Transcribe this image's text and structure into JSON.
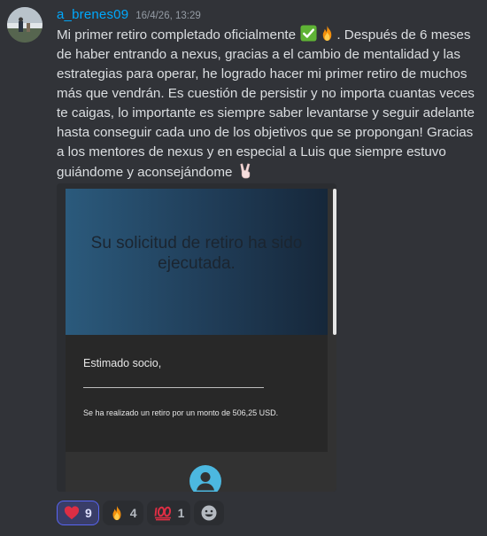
{
  "message": {
    "username": "a_brenes09",
    "timestamp": "16/4/26, 13:29",
    "text_part1": "Mi primer retiro completado oficialmente ",
    "text_part2": ". Después de 6 meses de haber entrando a nexus, gracias a el cambio de mentalidad y las estrategias para operar, he logrado hacer mi primer retiro de muchos más que vendrán. Es cuestión de persistir y no importa cuantas veces te caigas, lo importante es siempre saber levantarse y seguir adelante hasta conseguir cada uno de los objetivos que se propongan! Gracias a los mentores de nexus y en especial a Luis que siempre estuvo guiándome y aconsejándome ",
    "inline_emojis": [
      "check-mark-emoji",
      "fire-emoji",
      "victory-hand-emoji"
    ]
  },
  "embed": {
    "hero_title": "Su solicitud de retiro ha sido ejecutada.",
    "greeting": "Estimado socio,",
    "info": "Se ha realizado un retiro por un monto de 506,25 USD."
  },
  "reactions": [
    {
      "emoji": "heart",
      "count": "9",
      "active": true
    },
    {
      "emoji": "fire",
      "count": "4",
      "active": false
    },
    {
      "emoji": "hundred-points",
      "count": "1",
      "active": false
    }
  ],
  "colors": {
    "background": "#313338",
    "username": "#00a8fc",
    "active_reaction_border": "#5865f2",
    "user_icon": "#4cb8e0"
  }
}
